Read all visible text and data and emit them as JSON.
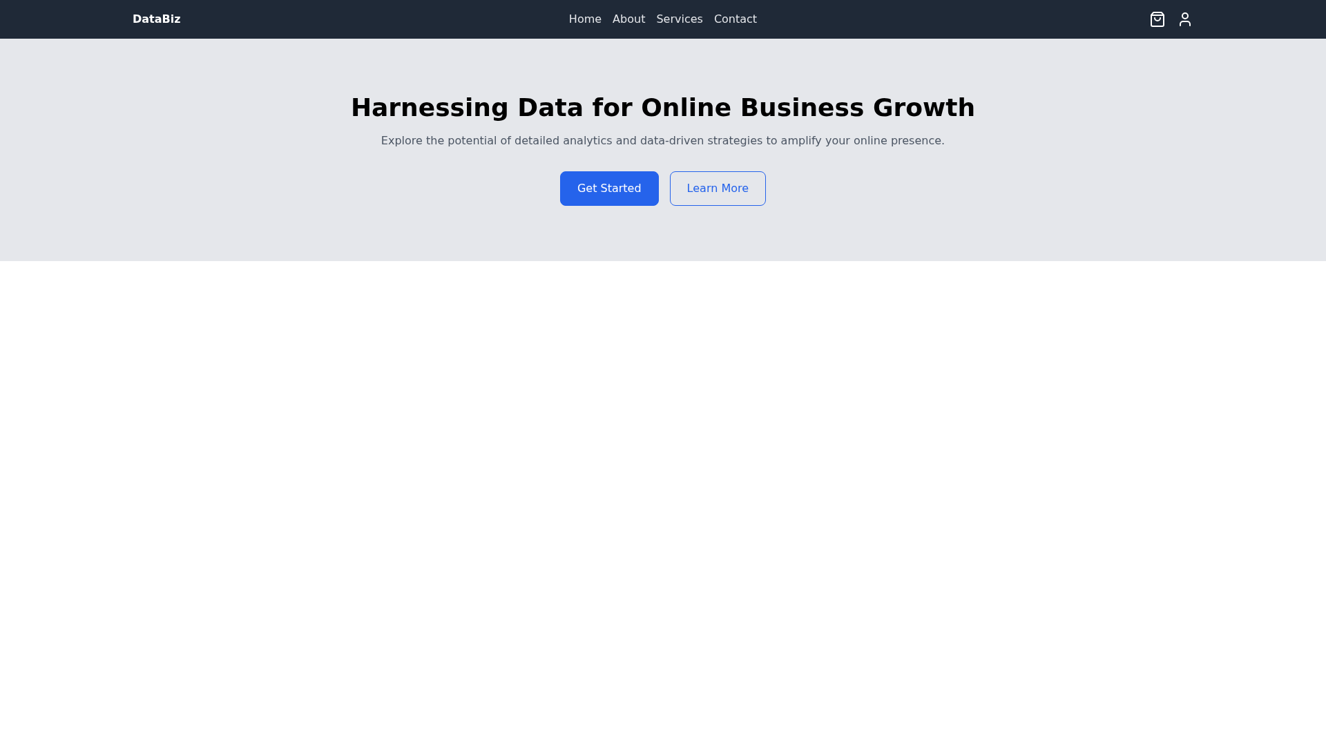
{
  "nav": {
    "logo": "DataBiz",
    "links": [
      {
        "label": "Home"
      },
      {
        "label": "About"
      },
      {
        "label": "Services"
      },
      {
        "label": "Contact"
      }
    ]
  },
  "hero": {
    "title": "Harnessing Data for Online Business Growth",
    "subtitle": "Explore the potential of detailed analytics and data-driven strategies to amplify your online presence.",
    "buttons": [
      {
        "label": "Get Started",
        "kind": "primary"
      },
      {
        "label": "Learn More",
        "kind": "outline"
      }
    ]
  }
}
